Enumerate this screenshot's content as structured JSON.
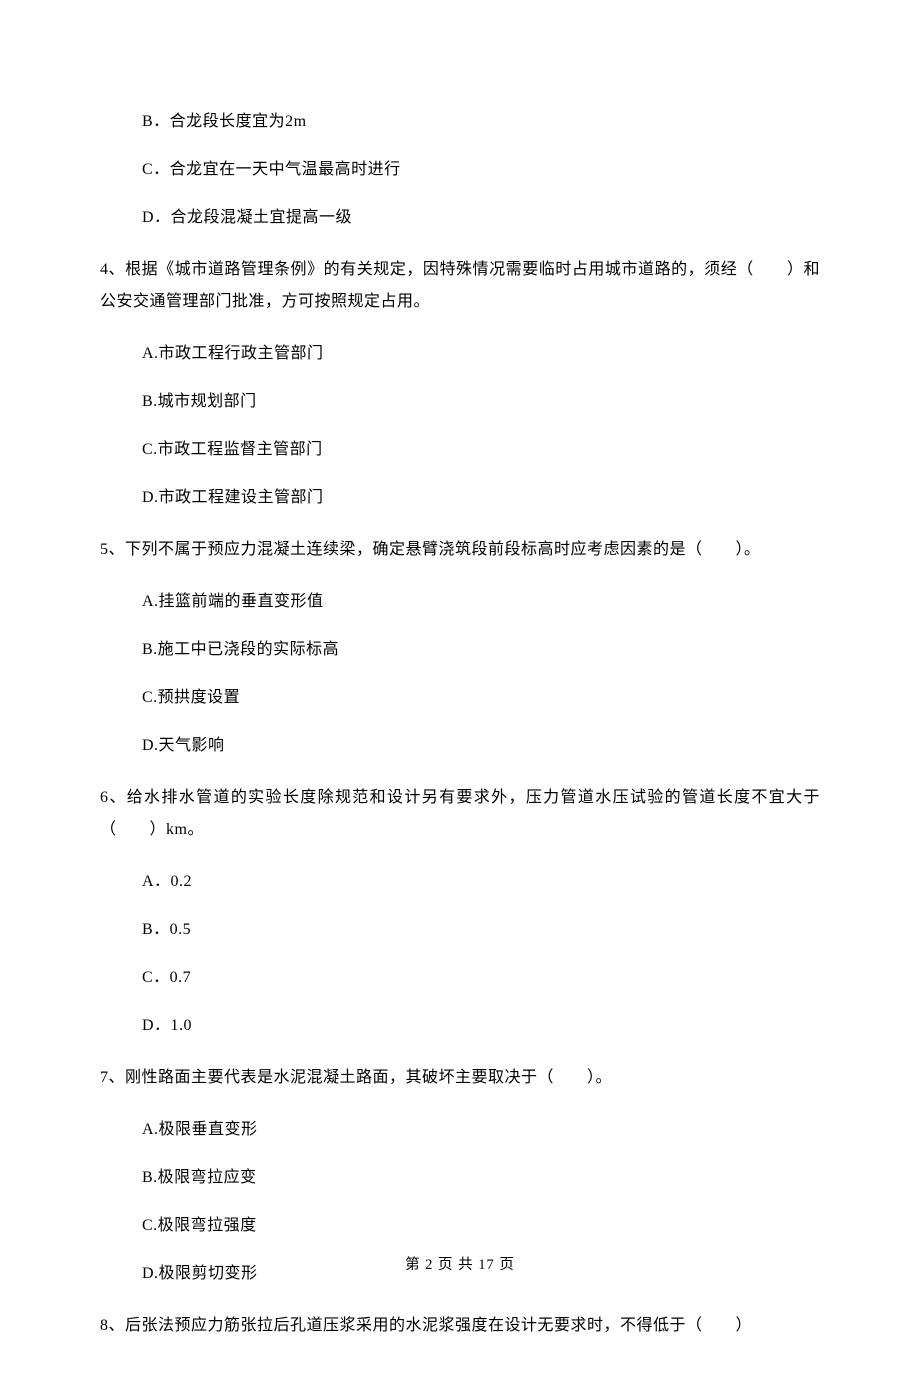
{
  "orphan_options": [
    "B．合龙段长度宜为2m",
    "C．合龙宜在一天中气温最高时进行",
    "D．合龙段混凝土宜提高一级"
  ],
  "questions": [
    {
      "text": "4、根据《城市道路管理条例》的有关规定，因特殊情况需要临时占用城市道路的，须经（　　）和公安交通管理部门批准，方可按照规定占用。",
      "options": [
        "A.市政工程行政主管部门",
        "B.城市规划部门",
        "C.市政工程监督主管部门",
        "D.市政工程建设主管部门"
      ]
    },
    {
      "text": "5、下列不属于预应力混凝土连续梁，确定悬臂浇筑段前段标高时应考虑因素的是（　　）。",
      "options": [
        "A.挂篮前端的垂直变形值",
        "B.施工中已浇段的实际标高",
        "C.预拱度设置",
        "D.天气影响"
      ]
    },
    {
      "text": "6、给水排水管道的实验长度除规范和设计另有要求外，压力管道水压试验的管道长度不宜大于（　　）km。",
      "options": [
        "A．0.2",
        "B．0.5",
        "C．0.7",
        "D．1.0"
      ]
    },
    {
      "text": "7、刚性路面主要代表是水泥混凝土路面，其破坏主要取决于（　　）。",
      "options": [
        "A.极限垂直变形",
        "B.极限弯拉应变",
        "C.极限弯拉强度",
        "D.极限剪切变形"
      ]
    },
    {
      "text": "8、后张法预应力筋张拉后孔道压浆采用的水泥浆强度在设计无要求时，不得低于（　　）",
      "options": []
    }
  ],
  "footer": "第 2 页 共 17 页"
}
